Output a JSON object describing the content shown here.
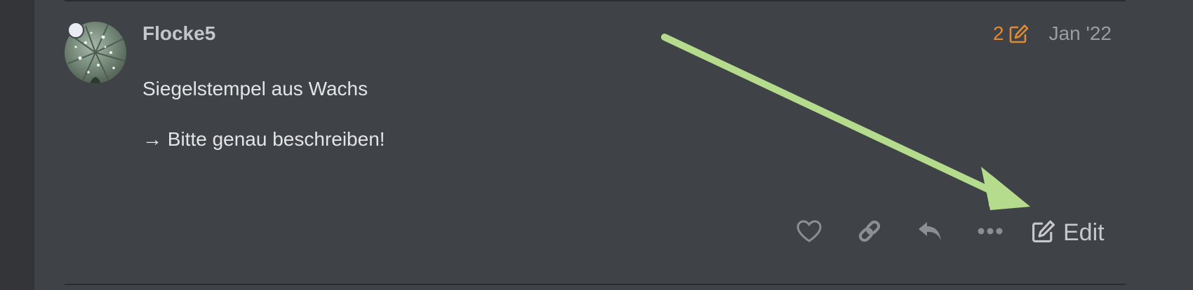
{
  "post": {
    "username": "Flocke5",
    "edit_count": "2",
    "date": "Jan '22",
    "body": [
      "Siegelstempel aus Wachs",
      "→ Bitte genau beschreiben!"
    ]
  },
  "actions": {
    "like_icon": "heart-icon",
    "link_icon": "link-icon",
    "reply_icon": "reply-icon",
    "more_icon": "ellipsis-icon",
    "edit_label": "Edit"
  },
  "colors": {
    "background": "#3f4246",
    "gutter": "#333538",
    "accent_orange": "#e08a33",
    "arrow_green": "#b5dc8c",
    "text_primary": "#e3e4e6",
    "text_muted": "#9a9da1"
  }
}
